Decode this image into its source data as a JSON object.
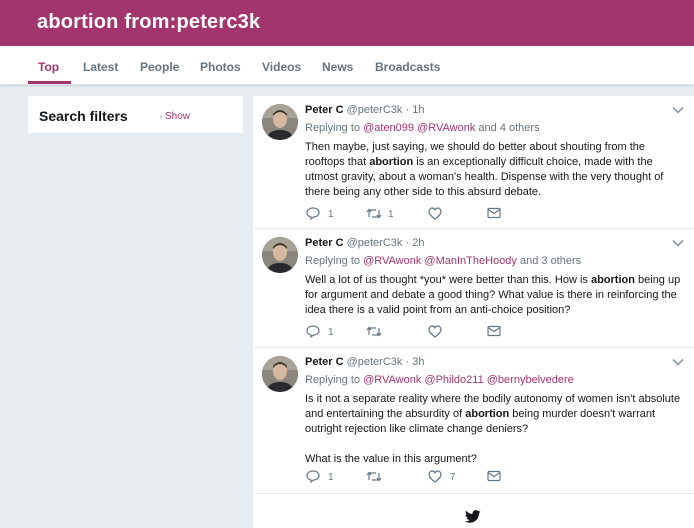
{
  "header": {
    "title": "abortion from:peterc3k"
  },
  "tabs": [
    {
      "label": "Top",
      "active": true
    },
    {
      "label": "Latest"
    },
    {
      "label": "People"
    },
    {
      "label": "Photos"
    },
    {
      "label": "Videos"
    },
    {
      "label": "News"
    },
    {
      "label": "Broadcasts"
    }
  ],
  "filters": {
    "title": "Search filters",
    "separator": "·",
    "show_label": "Show"
  },
  "accent_color": "#a3356e",
  "tweets": [
    {
      "name": "Peter C",
      "handle": "@peterC3k",
      "sep": "·",
      "time": "1h",
      "replying_prefix": "Replying to",
      "mentions": [
        "@aten099",
        "@RVAwonk"
      ],
      "replying_suffix": "and 4 others",
      "text_before": "Then maybe, just saying, we should do better about shouting from the rooftops that ",
      "highlight": "abortion",
      "text_after": " is an exceptionally difficult choice, made with the utmost gravity, about a woman's health. Dispense with the very thought of there being any other side to this absurd debate.",
      "replies": "1",
      "retweets": "1",
      "likes": ""
    },
    {
      "name": "Peter C",
      "handle": "@peterC3k",
      "sep": "·",
      "time": "2h",
      "replying_prefix": "Replying to",
      "mentions": [
        "@RVAwonk",
        "@ManInTheHoody"
      ],
      "replying_suffix": "and 3 others",
      "text_before": "Well a lot of us thought *you* were better than this. How is ",
      "highlight": "abortion",
      "text_after": " being up for argument and debate a good thing? What value is there in reinforcing the idea there is a valid point from an anti-choice position?",
      "replies": "1",
      "retweets": "",
      "likes": ""
    },
    {
      "name": "Peter C",
      "handle": "@peterC3k",
      "sep": "·",
      "time": "3h",
      "replying_prefix": "Replying to",
      "mentions": [
        "@RVAwonk",
        "@Phildo211",
        "@bernybelvedere"
      ],
      "replying_suffix": "",
      "text_before": "Is it not a separate reality where the bodily autonomy of women isn't absolute and entertaining the absurdity of ",
      "highlight": "abortion",
      "text_after": " being murder doesn't warrant outright rejection like climate change deniers?",
      "text_extra": "What is the value in this argument?",
      "replies": "1",
      "retweets": "",
      "likes": "7"
    }
  ],
  "icons": [
    "caret-down-icon",
    "reply-icon",
    "retweet-icon",
    "like-icon",
    "direct-message-icon",
    "twitter-bird-icon"
  ]
}
